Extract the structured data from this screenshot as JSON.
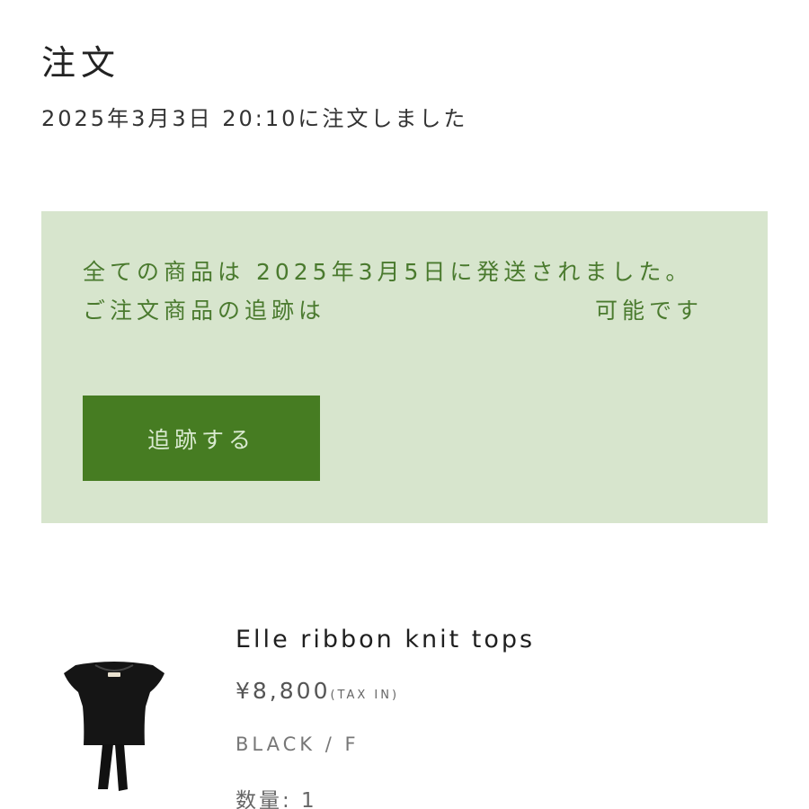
{
  "page": {
    "title": "注文",
    "order_date_text": "2025年3月3日 20:10に注文しました"
  },
  "notice": {
    "message": "全ての商品は 2025年3月5日に発送されました。 ご注文商品の追跡は　　　　　　　　　　可能です",
    "track_button_label": "追跡する"
  },
  "product": {
    "image_icon": "black-knit-top-image",
    "name": "Elle ribbon knit tops",
    "price": "¥8,800",
    "tax_label": "(TAX IN)",
    "variant": "BLACK / F",
    "quantity_text": "数量: 1"
  },
  "colors": {
    "notice_background": "#d7e5cd",
    "notice_text": "#4a7a2e",
    "button_background": "#467c22",
    "button_text": "#d9ead0"
  }
}
